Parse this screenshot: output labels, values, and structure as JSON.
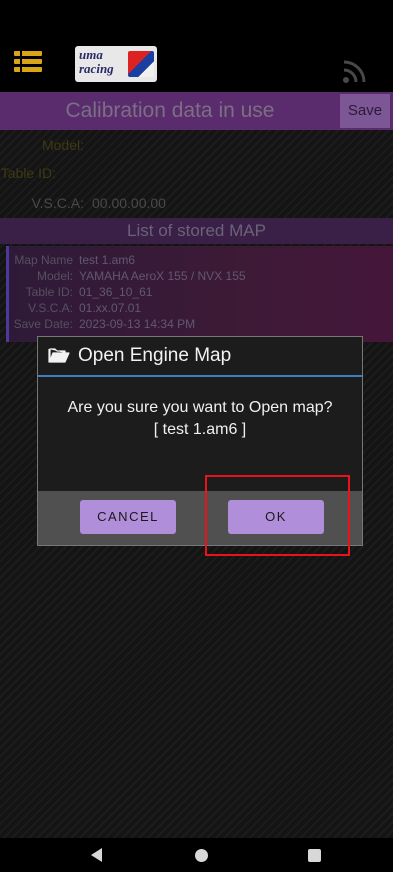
{
  "header": {
    "logo_text": "uma racing",
    "menu_icon": "menu-icon",
    "feed_icon": "rss-icon"
  },
  "calibration": {
    "title": "Calibration data in use",
    "save_label": "Save",
    "model_label": "Model:",
    "model_value": "",
    "table_id_label": "Table ID:",
    "table_id_value": "",
    "vsca_label": "V.S.C.A:",
    "vsca_value": "00.00.00.00"
  },
  "stored_maps": {
    "title": "List of stored MAP",
    "items": [
      {
        "map_name_label": "Map Name :",
        "map_name": "test 1.am6",
        "model_label": "Model:",
        "model": "YAMAHA AeroX 155 / NVX 155",
        "table_id_label": "Table ID:",
        "table_id": "01_36_10_61",
        "vsca_label": "V.S.C.A:",
        "vsca": "01.xx.07.01",
        "save_date_label": "Save Date:",
        "save_date": "2023-09-13 14:34 PM"
      }
    ]
  },
  "dialog": {
    "title": "Open Engine Map",
    "icon": "folder-open-icon",
    "message": "Are you sure you want to Open map?",
    "filename": "[ test 1.am6 ]",
    "cancel_label": "CANCEL",
    "ok_label": "OK"
  },
  "colors": {
    "accent": "#5a2c6e",
    "button": "#b08ed9",
    "divider": "#3c7fc2",
    "highlight": "#e8141b"
  }
}
